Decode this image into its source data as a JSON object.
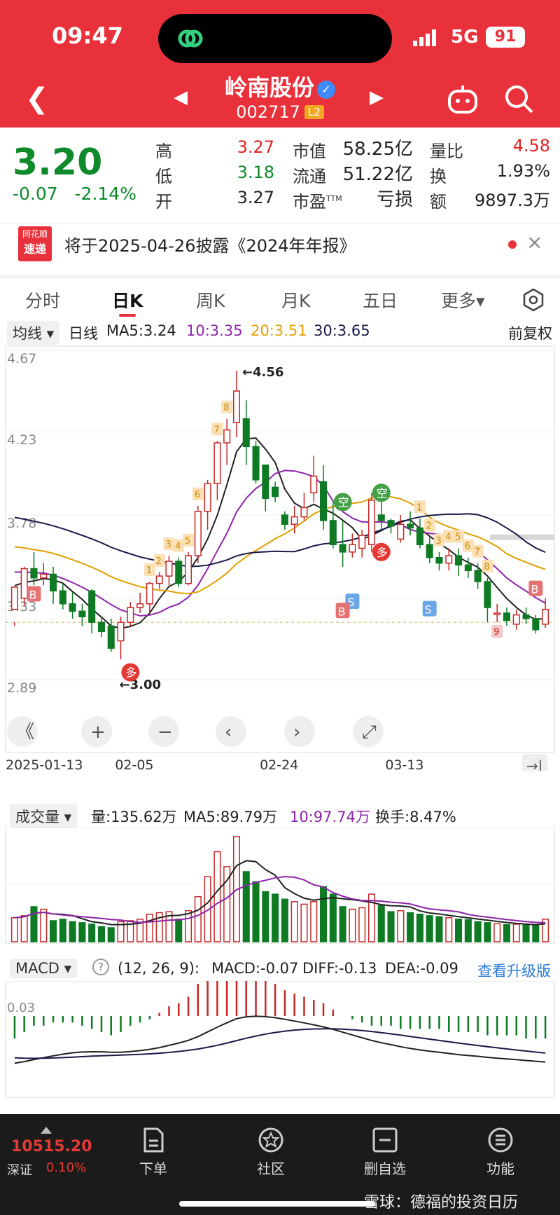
{
  "status": {
    "time": "09:47",
    "network": "5G",
    "battery": "91"
  },
  "header": {
    "title": "岭南股份",
    "code": "002717",
    "badge": "L2"
  },
  "quote": {
    "price": "3.20",
    "change": "-0.07",
    "change_pct": "-2.14%",
    "high_label": "高",
    "high": "3.27",
    "low_label": "低",
    "low": "3.18",
    "open_label": "开",
    "open": "3.27",
    "mktcap_label": "市值",
    "mktcap": "58.25亿",
    "float_label": "流通",
    "float": "51.22亿",
    "pe_label": "市盈",
    "pe_sup": "TTM",
    "pe": "亏损",
    "volratio_label": "量比",
    "volratio": "4.58",
    "turnover_label": "换",
    "turnover": "1.93%",
    "amount_label": "额",
    "amount": "9897.3万"
  },
  "notice": {
    "logo_top": "同花顺",
    "logo_bottom": "速递",
    "text": "将于2025-04-26披露《2024年年报》",
    "close": "×"
  },
  "tabs": [
    "分时",
    "日K",
    "周K",
    "月K",
    "五日",
    "更多▾"
  ],
  "ma_row": {
    "type": "均线",
    "period": "日线",
    "ma5": "MA5:3.24",
    "ma10": "10:3.35",
    "ma20": "20:3.51",
    "ma30": "30:3.65",
    "adjust": "前复权"
  },
  "vol_row": {
    "type": "成交量",
    "vol": "量:135.62万",
    "ma5": "MA5:89.79万",
    "ma10": "10:97.74万",
    "turnover": "换手:8.47%"
  },
  "macd_row": {
    "type": "MACD",
    "help": "?",
    "params": "(12, 26, 9):",
    "macd": "MACD:-0.07",
    "diff": "DIFF:-0.13",
    "dea": "DEA:-0.09",
    "upgrade": "查看升级版"
  },
  "colors": {
    "up": "#c62828",
    "down": "#0e7a24",
    "ma5": "#222222",
    "ma10": "#8e24aa",
    "ma20": "#e0a000",
    "ma30": "#1a1a4a",
    "header": "#e9313b"
  },
  "chart_data": {
    "type": "candlestick",
    "y_ticks": [
      "4.67",
      "4.23",
      "3.78",
      "3.33",
      "2.89"
    ],
    "ylim": [
      2.89,
      4.67
    ],
    "x_ticks": [
      "2025-01-13",
      "02-05",
      "02-24",
      "03-13"
    ],
    "max_label": "4.56",
    "min_label": "3.00",
    "signal_labels": [
      "B",
      "S",
      "多",
      "空",
      "B",
      "S",
      "多",
      "空",
      "B"
    ],
    "seq_labels": [
      "1",
      "2",
      "3",
      "4",
      "5",
      "6",
      "7",
      "8",
      "1",
      "2",
      "3",
      "4",
      "5",
      "6",
      "7",
      "8",
      "9"
    ],
    "candles": [
      [
        3.27,
        3.39,
        3.2,
        3.18
      ],
      [
        3.33,
        3.49,
        3.5,
        3.29
      ],
      [
        3.49,
        3.44,
        3.58,
        3.4
      ],
      [
        3.44,
        3.46,
        3.52,
        3.4
      ],
      [
        3.46,
        3.37,
        3.5,
        3.3
      ],
      [
        3.37,
        3.3,
        3.41,
        3.27
      ],
      [
        3.3,
        3.26,
        3.36,
        3.22
      ],
      [
        3.26,
        3.23,
        3.3,
        3.18
      ],
      [
        3.37,
        3.2,
        3.38,
        3.14
      ],
      [
        3.2,
        3.15,
        3.23,
        3.12
      ],
      [
        3.18,
        3.06,
        3.22,
        3.04
      ],
      [
        3.1,
        3.2,
        3.23,
        3.0
      ],
      [
        3.2,
        3.28,
        3.31,
        3.18
      ],
      [
        3.28,
        3.3,
        3.36,
        3.25
      ],
      [
        3.3,
        3.41,
        3.42,
        3.25
      ],
      [
        3.41,
        3.45,
        3.47,
        3.38
      ],
      [
        3.45,
        3.53,
        3.56,
        3.4
      ],
      [
        3.53,
        3.41,
        3.55,
        3.39
      ],
      [
        3.41,
        3.56,
        3.58,
        3.4
      ],
      [
        3.56,
        3.8,
        3.83,
        3.52
      ],
      [
        3.8,
        3.95,
        3.97,
        3.7
      ],
      [
        3.95,
        4.17,
        4.18,
        3.86
      ],
      [
        4.17,
        4.24,
        4.3,
        4.05
      ],
      [
        4.28,
        4.45,
        4.56,
        4.2
      ],
      [
        4.3,
        4.15,
        4.4,
        4.05
      ],
      [
        4.15,
        3.97,
        4.18,
        3.95
      ],
      [
        4.05,
        3.87,
        4.05,
        3.8
      ],
      [
        3.93,
        3.88,
        3.96,
        3.85
      ],
      [
        3.78,
        3.73,
        3.8,
        3.7
      ],
      [
        3.73,
        3.77,
        3.83,
        3.68
      ],
      [
        3.77,
        3.82,
        3.9,
        3.75
      ],
      [
        3.9,
        3.99,
        4.1,
        3.85
      ],
      [
        3.96,
        3.75,
        4.05,
        3.7
      ],
      [
        3.75,
        3.62,
        3.85,
        3.6
      ],
      [
        3.62,
        3.58,
        3.75,
        3.5
      ],
      [
        3.58,
        3.62,
        3.68,
        3.55
      ],
      [
        3.6,
        3.67,
        3.7,
        3.55
      ],
      [
        3.62,
        3.86,
        3.9,
        3.58
      ],
      [
        3.78,
        3.75,
        3.85,
        3.7
      ],
      [
        3.75,
        3.72,
        3.76,
        3.68
      ],
      [
        3.65,
        3.73,
        3.78,
        3.63
      ],
      [
        3.73,
        3.71,
        3.8,
        3.67
      ],
      [
        3.71,
        3.62,
        3.76,
        3.6
      ],
      [
        3.62,
        3.55,
        3.66,
        3.52
      ],
      [
        3.55,
        3.52,
        3.58,
        3.48
      ],
      [
        3.52,
        3.56,
        3.6,
        3.48
      ],
      [
        3.56,
        3.51,
        3.6,
        3.45
      ],
      [
        3.51,
        3.48,
        3.55,
        3.44
      ],
      [
        3.48,
        3.42,
        3.52,
        3.38
      ],
      [
        3.42,
        3.28,
        3.44,
        3.2
      ],
      [
        3.25,
        3.25,
        3.3,
        3.2
      ],
      [
        3.25,
        3.21,
        3.28,
        3.18
      ],
      [
        3.19,
        3.24,
        3.27,
        3.16
      ],
      [
        3.24,
        3.22,
        3.28,
        3.19
      ],
      [
        3.22,
        3.16,
        3.24,
        3.14
      ],
      [
        3.19,
        3.27,
        3.33,
        3.17
      ]
    ],
    "volume": [
      48,
      52,
      70,
      65,
      42,
      45,
      40,
      38,
      35,
      30,
      28,
      40,
      42,
      45,
      55,
      58,
      60,
      45,
      62,
      90,
      130,
      180,
      150,
      210,
      140,
      120,
      100,
      95,
      85,
      80,
      75,
      80,
      110,
      95,
      70,
      65,
      68,
      95,
      72,
      60,
      62,
      58,
      55,
      52,
      50,
      48,
      45,
      44,
      40,
      38,
      36,
      34,
      35,
      33,
      32,
      45
    ],
    "macd_hist": [
      -0.07,
      -0.05,
      -0.03,
      -0.03,
      -0.02,
      -0.02,
      -0.02,
      -0.03,
      -0.04,
      -0.05,
      -0.06,
      -0.05,
      -0.03,
      -0.02,
      -0.01,
      0.01,
      0.03,
      0.04,
      0.06,
      0.1,
      0.14,
      0.16,
      0.17,
      0.18,
      0.17,
      0.14,
      0.12,
      0.1,
      0.08,
      0.07,
      0.06,
      0.05,
      0.04,
      0.02,
      0.0,
      -0.01,
      -0.02,
      -0.03,
      -0.03,
      -0.03,
      -0.04,
      -0.04,
      -0.04,
      -0.04,
      -0.04,
      -0.05,
      -0.05,
      -0.05,
      -0.05,
      -0.06,
      -0.06,
      -0.06,
      -0.06,
      -0.07,
      -0.07,
      -0.07
    ],
    "macd_yticks": [
      "0.03"
    ]
  },
  "bottom": {
    "index_value": "10515.20",
    "index_name": "深证",
    "index_pct": "0.10%",
    "items": [
      "下单",
      "社区",
      "删自选",
      "功能"
    ],
    "watermark": "雪球：德福的投资日历"
  }
}
